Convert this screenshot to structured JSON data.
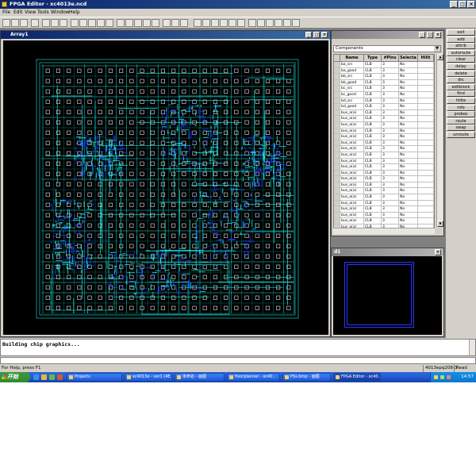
{
  "window": {
    "title": "FPGA Editor - xc4013e.ncd",
    "controls": [
      "_",
      "□",
      "×"
    ]
  },
  "menu": [
    "File",
    "Edit",
    "View",
    "Tools",
    "Window",
    "Help"
  ],
  "array_window": {
    "title": "Array1"
  },
  "list_window": {
    "title": "",
    "filter_value": "Components",
    "columns": [
      "",
      "Name",
      "Type",
      "#Pins",
      "Selecta",
      "Hilit"
    ],
    "rows": [
      [
        "",
        "ba_src",
        "CLB",
        "3",
        "No",
        ""
      ],
      [
        "",
        "ba_good",
        "CLB",
        "3",
        "No",
        ""
      ],
      [
        "",
        "bb_src",
        "CLB",
        "3",
        "No",
        ""
      ],
      [
        "",
        "bb_good",
        "CLB",
        "3",
        "No",
        ""
      ],
      [
        "",
        "bc_src",
        "CLB",
        "3",
        "No",
        ""
      ],
      [
        "",
        "bc_good",
        "CLB",
        "3",
        "No",
        ""
      ],
      [
        "",
        "bd_src",
        "CLB",
        "3",
        "No",
        ""
      ],
      [
        "",
        "bd_good",
        "CLB",
        "3",
        "No",
        ""
      ],
      [
        "",
        "bus_a(a)",
        "CLB",
        "3",
        "No",
        ""
      ],
      [
        "",
        "bus_a(a)",
        "CLB",
        "3",
        "No",
        ""
      ],
      [
        "",
        "bus_a(a)",
        "CLB",
        "3",
        "No",
        ""
      ],
      [
        "",
        "bus_a(a)",
        "CLB",
        "3",
        "No",
        ""
      ],
      [
        "",
        "bus_a(a)",
        "CLB",
        "3",
        "No",
        ""
      ],
      [
        "",
        "bus_a(a)",
        "CLB",
        "3",
        "No",
        ""
      ],
      [
        "",
        "bus_a(a)",
        "CLB",
        "3",
        "No",
        ""
      ],
      [
        "",
        "bus_a(a)",
        "CLB",
        "3",
        "No",
        ""
      ],
      [
        "",
        "bus_a(a)",
        "CLB",
        "3",
        "No",
        ""
      ],
      [
        "",
        "bus_a(a)",
        "CLB",
        "3",
        "No",
        ""
      ],
      [
        "",
        "bus_a(a)",
        "CLB",
        "3",
        "No",
        ""
      ],
      [
        "",
        "bus_a(a)",
        "CLB",
        "3",
        "No",
        ""
      ],
      [
        "",
        "bus_a(a)",
        "CLB",
        "3",
        "No",
        ""
      ],
      [
        "",
        "bus_a(a)",
        "CLB",
        "3",
        "No",
        ""
      ],
      [
        "",
        "bus_a(a)",
        "CLB",
        "3",
        "No",
        ""
      ],
      [
        "",
        "bus_a(a)",
        "CLB",
        "3",
        "No",
        ""
      ],
      [
        "",
        "bus_a(a)",
        "CLB",
        "3",
        "No",
        ""
      ],
      [
        "",
        "bus_a(a)",
        "CLB",
        "3",
        "No",
        ""
      ],
      [
        "",
        "bus_a(a)",
        "CLB",
        "3",
        "No",
        ""
      ],
      [
        "",
        "bus_a(a)",
        "CLB",
        "3",
        "No",
        ""
      ]
    ]
  },
  "world_window": {
    "title": "d1"
  },
  "commands": [
    "exit",
    "add",
    "attrib",
    "autoroute",
    "clear",
    "delay",
    "delete",
    "drc",
    "editblock",
    "find",
    "hilite",
    "info",
    "probes",
    "route",
    "swap",
    "unroute"
  ],
  "console": {
    "lines": [
      "Building chip graphics..."
    ]
  },
  "status": {
    "help": "For Help, press F1",
    "device": "4013epq208-3",
    "mode": "Read Only"
  },
  "taskbar": {
    "start_label": "开始",
    "tasks": [
      {
        "label": "Projects"
      },
      {
        "label": "xc4013e - ver1 (4E..."
      },
      {
        "label": "未命名 - 画图"
      },
      {
        "label": "floorplanner - xc40..."
      },
      {
        "label": "PSs.bmp - 画图"
      },
      {
        "label": "FPGA Editor - xc40..."
      }
    ],
    "clock": "14:57"
  },
  "colors": {
    "title_blue": "#0a246a",
    "routing": "#19e6e0",
    "routing_dense": "#1b3cff",
    "bg_black": "#000000",
    "window_gray": "#d4d0c8"
  }
}
